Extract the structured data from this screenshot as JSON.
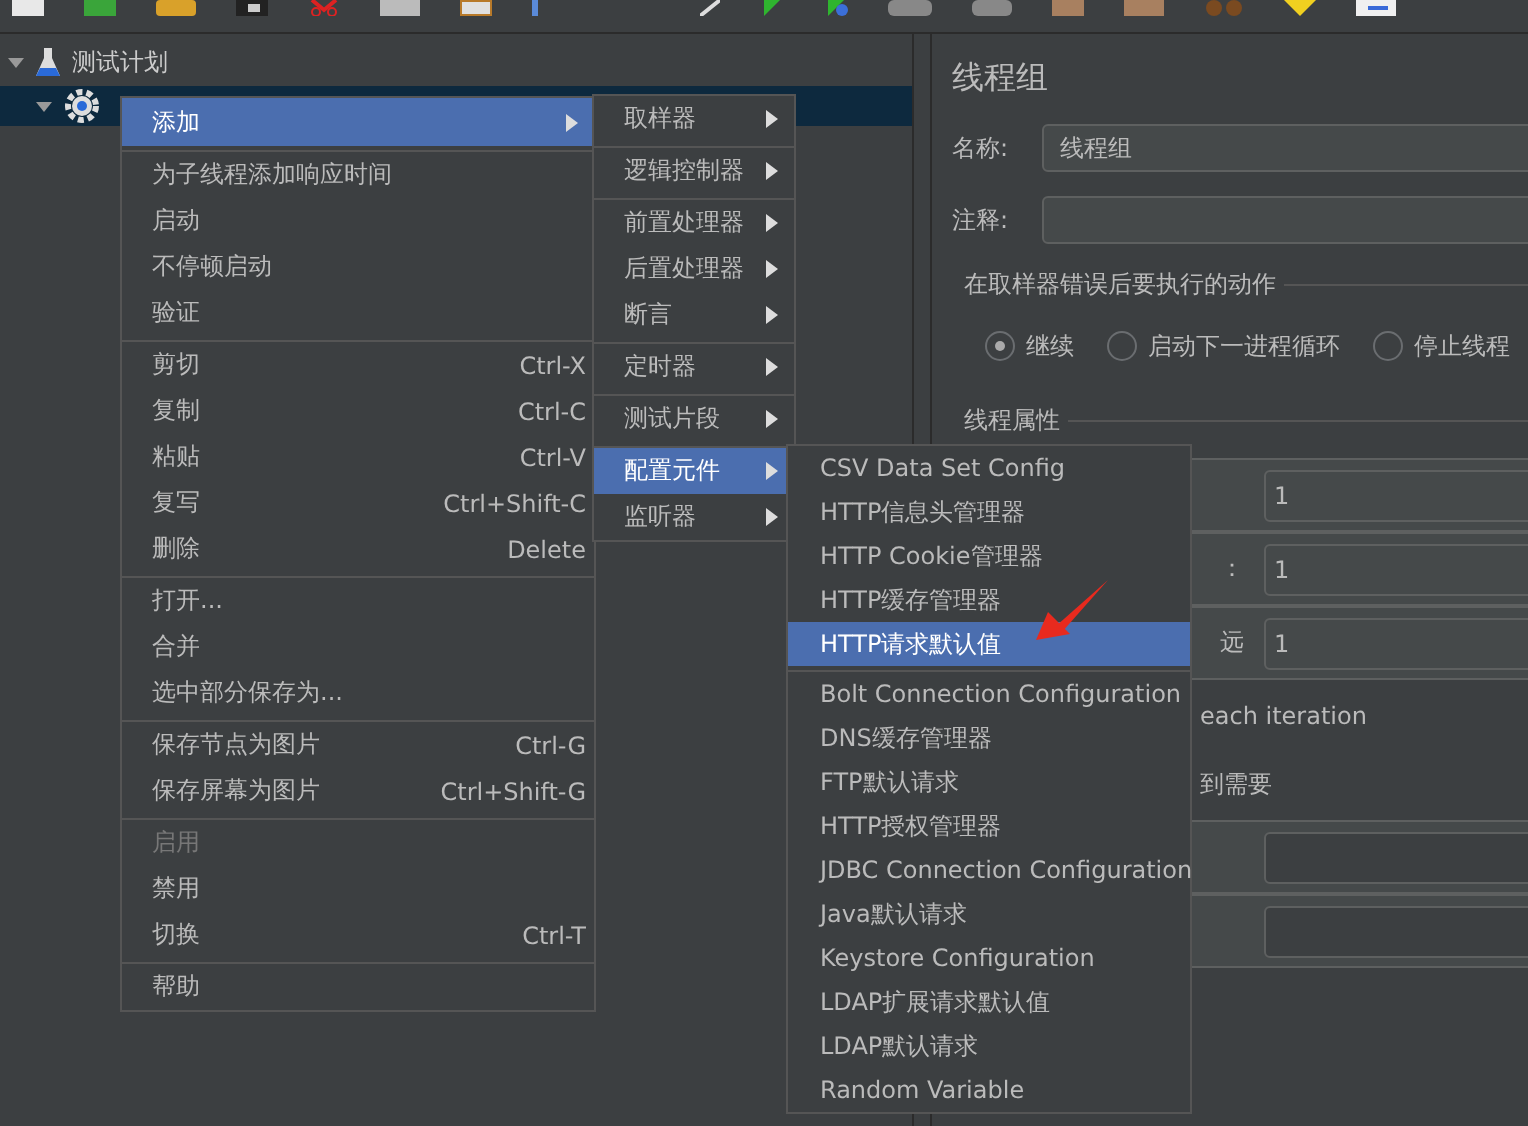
{
  "tree": [
    {
      "label": "测试计划",
      "selected": false,
      "expanded": true,
      "depth_children": [
        {
          "selected": true,
          "expanded": true
        }
      ]
    }
  ],
  "panel": {
    "title": "线程组",
    "name_label": "名称:",
    "name_value": "线程组",
    "comment_label": "注释:",
    "error_group": "在取样器错误后要执行的动作",
    "radios": [
      {
        "label": "继续",
        "selected": true
      },
      {
        "label": "启动下一进程循环",
        "selected": false
      },
      {
        "label": "停止线程",
        "selected": false
      }
    ],
    "props_group": "线程属性",
    "props": [
      {
        "kind": "field",
        "value": "1"
      },
      {
        "kind": "field",
        "label": "：",
        "value": "1"
      },
      {
        "kind": "field",
        "label": "远",
        "value": "1"
      },
      {
        "kind": "text",
        "label": "each iteration"
      },
      {
        "kind": "text",
        "label": "到需要"
      },
      {
        "kind": "field"
      },
      {
        "kind": "field"
      }
    ]
  },
  "context_menu": [
    {
      "label": "添加",
      "submenu": true,
      "selected": true,
      "disabled": false,
      "separator_before": false
    },
    {
      "label": "为子线程添加响应时间",
      "submenu": false,
      "selected": false,
      "disabled": false,
      "separator_before": true
    },
    {
      "label": "启动",
      "submenu": false,
      "selected": false,
      "disabled": false,
      "separator_before": false
    },
    {
      "label": "不停顿启动",
      "submenu": false,
      "selected": false,
      "disabled": false,
      "separator_before": false
    },
    {
      "label": "验证",
      "submenu": false,
      "selected": false,
      "disabled": false,
      "separator_before": false
    },
    {
      "label": "剪切",
      "shortcut": "Ctrl-X",
      "submenu": false,
      "selected": false,
      "disabled": false,
      "separator_before": true
    },
    {
      "label": "复制",
      "shortcut": "Ctrl-C",
      "submenu": false,
      "selected": false,
      "disabled": false,
      "separator_before": false
    },
    {
      "label": "粘贴",
      "shortcut": "Ctrl-V",
      "submenu": false,
      "selected": false,
      "disabled": false,
      "separator_before": false
    },
    {
      "label": "复写",
      "shortcut": "Ctrl+Shift-C",
      "submenu": false,
      "selected": false,
      "disabled": false,
      "separator_before": false
    },
    {
      "label": "删除",
      "shortcut": "Delete",
      "submenu": false,
      "selected": false,
      "disabled": false,
      "separator_before": false
    },
    {
      "label": "打开...",
      "submenu": false,
      "selected": false,
      "disabled": false,
      "separator_before": true
    },
    {
      "label": "合并",
      "submenu": false,
      "selected": false,
      "disabled": false,
      "separator_before": false
    },
    {
      "label": "选中部分保存为...",
      "submenu": false,
      "selected": false,
      "disabled": false,
      "separator_before": false
    },
    {
      "label": "保存节点为图片",
      "shortcut": "Ctrl-G",
      "submenu": false,
      "selected": false,
      "disabled": false,
      "separator_before": true
    },
    {
      "label": "保存屏幕为图片",
      "shortcut": "Ctrl+Shift-G",
      "submenu": false,
      "selected": false,
      "disabled": false,
      "separator_before": false
    },
    {
      "label": "启用",
      "submenu": false,
      "selected": false,
      "disabled": true,
      "separator_before": true
    },
    {
      "label": "禁用",
      "submenu": false,
      "selected": false,
      "disabled": false,
      "separator_before": false
    },
    {
      "label": "切换",
      "shortcut": "Ctrl-T",
      "submenu": false,
      "selected": false,
      "disabled": false,
      "separator_before": false
    },
    {
      "label": "帮助",
      "submenu": false,
      "selected": false,
      "disabled": false,
      "separator_before": true
    }
  ],
  "add_submenu": [
    {
      "label": "取样器",
      "submenu": true,
      "selected": false,
      "separator_before": false
    },
    {
      "label": "逻辑控制器",
      "submenu": true,
      "selected": false,
      "separator_before": true
    },
    {
      "label": "前置处理器",
      "submenu": true,
      "selected": false,
      "separator_before": true
    },
    {
      "label": "后置处理器",
      "submenu": true,
      "selected": false,
      "separator_before": false
    },
    {
      "label": "断言",
      "submenu": true,
      "selected": false,
      "separator_before": false
    },
    {
      "label": "定时器",
      "submenu": true,
      "selected": false,
      "separator_before": true
    },
    {
      "label": "测试片段",
      "submenu": true,
      "selected": false,
      "separator_before": true
    },
    {
      "label": "配置元件",
      "submenu": true,
      "selected": true,
      "separator_before": true
    },
    {
      "label": "监听器",
      "submenu": true,
      "selected": false,
      "separator_before": false
    }
  ],
  "config_submenu": [
    {
      "label": "CSV Data Set Config",
      "selected": false,
      "separator_before": false
    },
    {
      "label": "HTTP信息头管理器",
      "selected": false,
      "separator_before": false
    },
    {
      "label": "HTTP Cookie管理器",
      "selected": false,
      "separator_before": false
    },
    {
      "label": "HTTP缓存管理器",
      "selected": false,
      "separator_before": false
    },
    {
      "label": "HTTP请求默认值",
      "selected": true,
      "separator_before": false
    },
    {
      "label": "Bolt Connection Configuration",
      "selected": false,
      "separator_before": true
    },
    {
      "label": "DNS缓存管理器",
      "selected": false,
      "separator_before": false
    },
    {
      "label": "FTP默认请求",
      "selected": false,
      "separator_before": false
    },
    {
      "label": "HTTP授权管理器",
      "selected": false,
      "separator_before": false
    },
    {
      "label": "JDBC Connection Configuration",
      "selected": false,
      "separator_before": false
    },
    {
      "label": "Java默认请求",
      "selected": false,
      "separator_before": false
    },
    {
      "label": "Keystore Configuration",
      "selected": false,
      "separator_before": false
    },
    {
      "label": "LDAP扩展请求默认值",
      "selected": false,
      "separator_before": false
    },
    {
      "label": "LDAP默认请求",
      "selected": false,
      "separator_before": false
    },
    {
      "label": "Random Variable",
      "selected": false,
      "separator_before": false
    }
  ]
}
